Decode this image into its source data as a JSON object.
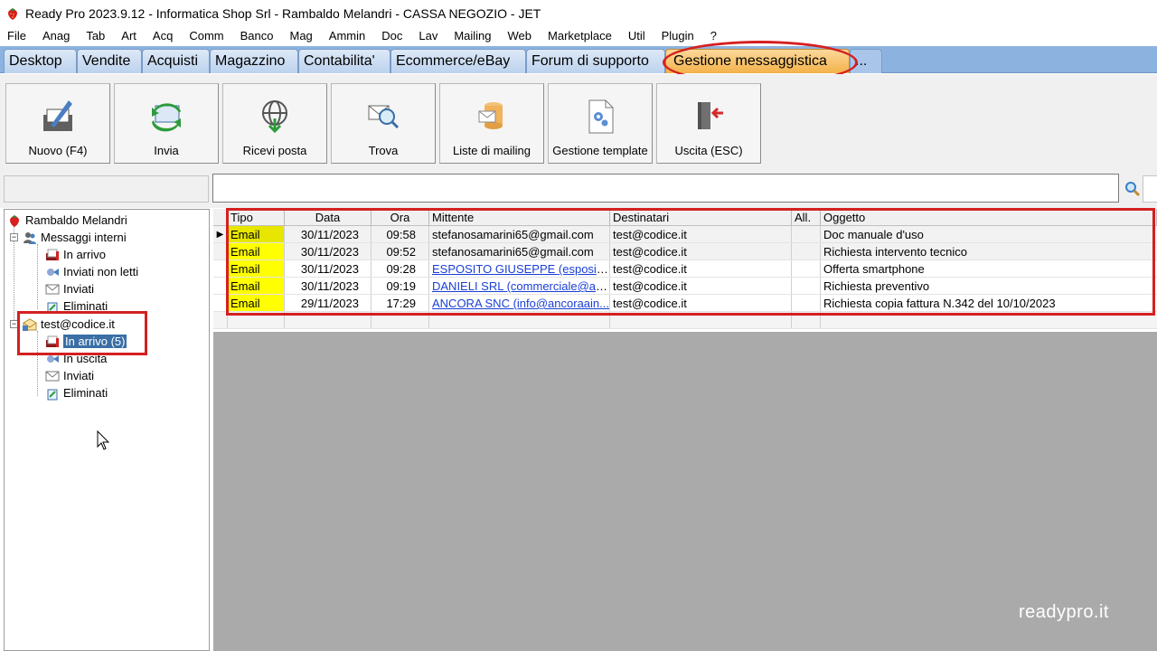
{
  "window": {
    "title": "Ready Pro 2023.9.12 - Informatica Shop Srl - Rambaldo Melandri - CASSA NEGOZIO - JET"
  },
  "menubar": [
    "File",
    "Anag",
    "Tab",
    "Art",
    "Acq",
    "Comm",
    "Banco",
    "Mag",
    "Ammin",
    "Doc",
    "Lav",
    "Mailing",
    "Web",
    "Marketplace",
    "Util",
    "Plugin",
    "?"
  ],
  "tabs": [
    "Desktop",
    "Vendite",
    "Acquisti",
    "Magazzino",
    "Contabilita'",
    "Ecommerce/eBay",
    "Forum di supporto",
    "Gestione messaggistica",
    "..."
  ],
  "active_tab": "Gestione messaggistica",
  "toolbar": {
    "new_label": "Nuovo (F4)",
    "send_label": "Invia",
    "receive_label": "Ricevi posta",
    "find_label": "Trova",
    "mailing_lists_label": "Liste di mailing",
    "templates_label": "Gestione template",
    "exit_label": "Uscita (ESC)"
  },
  "search": {
    "value": ""
  },
  "tree": {
    "user": "Rambaldo Melandri",
    "internal_group": "Messaggi interni",
    "internal_items": [
      "In arrivo",
      "Inviati non letti",
      "Inviati",
      "Eliminati"
    ],
    "account": "test@codice.it",
    "account_items": [
      "In arrivo (5)",
      "In uscita",
      "Inviati",
      "Eliminati"
    ],
    "selected": "In arrivo (5)"
  },
  "grid": {
    "columns": {
      "tipo": "Tipo",
      "data": "Data",
      "ora": "Ora",
      "mittente": "Mittente",
      "destinatari": "Destinatari",
      "allegati": "All.",
      "oggetto": "Oggetto"
    },
    "rows": [
      {
        "tipo": "Email",
        "data": "30/11/2023",
        "ora": "09:58",
        "mittente": "stefanosamarini65@gmail.com",
        "destinatari": "test@codice.it",
        "allegati": "",
        "oggetto": "Doc manuale d'uso",
        "link": false
      },
      {
        "tipo": "Email",
        "data": "30/11/2023",
        "ora": "09:52",
        "mittente": "stefanosamarini65@gmail.com",
        "destinatari": "test@codice.it",
        "allegati": "",
        "oggetto": "Richiesta intervento tecnico",
        "link": false
      },
      {
        "tipo": "Email",
        "data": "30/11/2023",
        "ora": "09:28",
        "mittente": "ESPOSITO GIUSEPPE (esposito...",
        "destinatari": "test@codice.it",
        "allegati": "",
        "oggetto": "Offerta smartphone",
        "link": true
      },
      {
        "tipo": "Email",
        "data": "30/11/2023",
        "ora": "09:19",
        "mittente": "DANIELI SRL (commerciale@azi...",
        "destinatari": "test@codice.it",
        "allegati": "",
        "oggetto": "Richiesta preventivo",
        "link": true
      },
      {
        "tipo": "Email",
        "data": "29/11/2023",
        "ora": "17:29",
        "mittente": "ANCORA SNC (info@ancoraain...",
        "destinatari": "test@codice.it",
        "allegati": "",
        "oggetto": "Richiesta copia fattura N.342 del 10/10/2023",
        "link": true
      }
    ]
  },
  "watermark": "readypro.it",
  "colors": {
    "tab_strip": "#8cb3e0",
    "active_tab": "#f4b24a",
    "highlight": "#d42020",
    "tipo_cell": "#ffff00",
    "link": "#1a3fd6"
  }
}
